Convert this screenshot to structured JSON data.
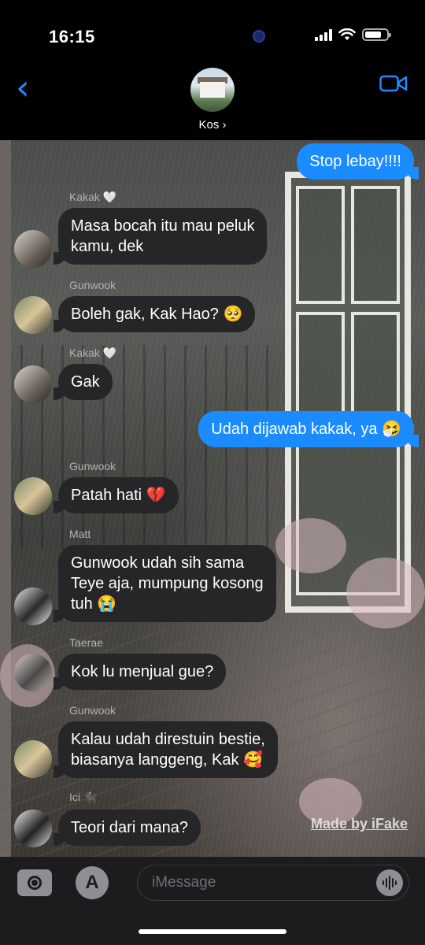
{
  "status_bar": {
    "time": "16:15",
    "battery_level": 0.75
  },
  "header": {
    "back_icon": "chevron-left-icon",
    "group_name": "Kos ›",
    "video_icon": "video-camera-icon"
  },
  "messages": [
    {
      "direction": "out",
      "text": "Stop lebay!!!!"
    },
    {
      "direction": "in",
      "sender": "Kakak 🤍",
      "text": "Masa bocah itu mau peluk\nkamu, dek",
      "avatar": "avatar-kakak"
    },
    {
      "direction": "in",
      "sender": "Gunwook",
      "text": "Boleh gak, Kak Hao? 🥺",
      "avatar": "avatar-gunwook"
    },
    {
      "direction": "in",
      "sender": "Kakak 🤍",
      "text": "Gak",
      "avatar": "avatar-kakak"
    },
    {
      "direction": "out",
      "text": "Udah dijawab kakak, ya 🤧"
    },
    {
      "direction": "in",
      "sender": "Gunwook",
      "text": "Patah hati 💔",
      "avatar": "avatar-gunwook"
    },
    {
      "direction": "in",
      "sender": "Matt",
      "text": "Gunwook udah sih sama\nTeye aja, mumpung kosong\ntuh 😭",
      "avatar": "avatar-matt"
    },
    {
      "direction": "in",
      "sender": "Taerae",
      "text": "Kok lu menjual gue?",
      "avatar": "avatar-taerae"
    },
    {
      "direction": "in",
      "sender": "Gunwook",
      "text": "Kalau udah direstuin bestie,\nbiasanya langgeng, Kak 🥰",
      "avatar": "avatar-gunwook"
    },
    {
      "direction": "in",
      "sender": "Ici 🐈‍⬛",
      "text": "Teori dari mana?",
      "avatar": "avatar-ici"
    }
  ],
  "watermark": "Made by iFake",
  "input_bar": {
    "camera_icon": "camera-icon",
    "appstore_icon": "app-store-icon",
    "appstore_glyph": "A",
    "placeholder": "iMessage",
    "audio_icon": "audio-waveform-icon"
  },
  "colors": {
    "outgoing_bubble": "#1a8cff",
    "incoming_bubble": "#262628",
    "accent": "#1a8cff"
  }
}
